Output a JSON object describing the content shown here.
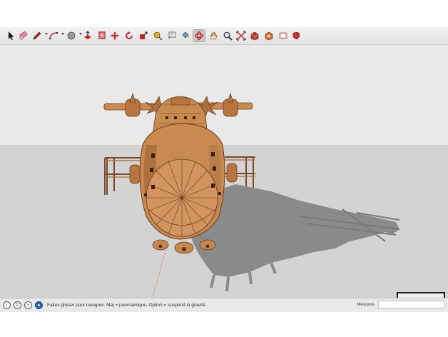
{
  "toolbar": {
    "tools": [
      {
        "name": "select-tool",
        "icon": "arrow-cursor-icon"
      },
      {
        "name": "eraser-tool",
        "icon": "eraser-icon"
      },
      {
        "name": "line-tool",
        "icon": "pencil-icon",
        "dropdown": true
      },
      {
        "name": "arc-tool",
        "icon": "arc-icon",
        "dropdown": true
      },
      {
        "name": "shape-tool",
        "icon": "circle-shape-icon",
        "dropdown": true
      },
      {
        "name": "push-pull-tool",
        "icon": "push-pull-icon"
      },
      {
        "name": "offset-tool",
        "icon": "offset-icon"
      },
      {
        "name": "move-tool",
        "icon": "move-arrows-icon"
      },
      {
        "name": "rotate-tool",
        "icon": "rotate-icon"
      },
      {
        "name": "scale-tool",
        "icon": "scale-icon"
      },
      {
        "name": "tape-measure-tool",
        "icon": "tape-measure-icon"
      },
      {
        "name": "text-tool",
        "icon": "text-icon"
      },
      {
        "name": "paint-bucket-tool",
        "icon": "paint-bucket-icon"
      },
      {
        "name": "orbit-tool",
        "icon": "orbit-icon",
        "active": true
      },
      {
        "name": "pan-tool",
        "icon": "hand-icon"
      },
      {
        "name": "zoom-tool",
        "icon": "magnifier-icon"
      },
      {
        "name": "zoom-extents-tool",
        "icon": "zoom-extents-icon"
      },
      {
        "name": "3d-warehouse-tool",
        "icon": "warehouse-icon"
      },
      {
        "name": "extension-warehouse-tool",
        "icon": "extension-icon"
      },
      {
        "name": "layout-tool",
        "icon": "layout-icon"
      },
      {
        "name": "ruby-console-tool",
        "icon": "ruby-icon"
      }
    ]
  },
  "colors": {
    "sky": "#e9e9e9",
    "ground": "#d3d3d3",
    "shadow": "#8a8a8a",
    "model": "#c98a52",
    "model_dark": "#8a5430",
    "toolbar_accent": "#c0282d"
  },
  "statusbar": {
    "icons": [
      "info-icon",
      "credits-icon",
      "user-icon",
      "geolocation-icon"
    ],
    "message": "Faites glisser pour naviguer. Maj = panoramique, Option =  suspend la gravité.",
    "measures_label": "Mesures",
    "measures_value": ""
  }
}
